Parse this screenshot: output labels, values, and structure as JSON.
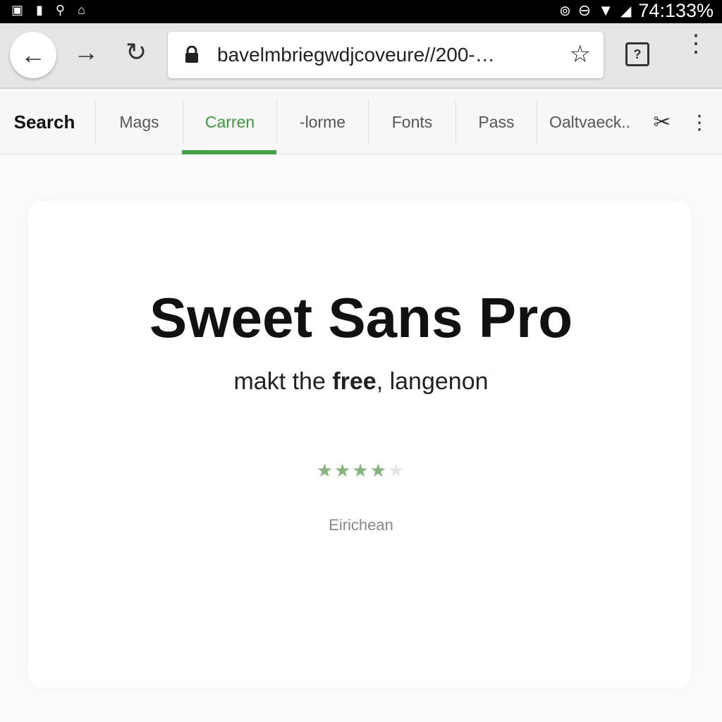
{
  "status_bar": {
    "time_battery": "74:133%"
  },
  "browser": {
    "url": "bavelmbriegwdjcoveure//200-…",
    "icons": [
      "back-arrow-icon",
      "forward-arrow-icon",
      "reload-icon",
      "lock-icon",
      "star-icon",
      "tabs-icon",
      "menu-icon"
    ],
    "tabs_count": "?"
  },
  "tabs": [
    {
      "label": "Search"
    },
    {
      "label": "Mags"
    },
    {
      "label": "Carren",
      "active": true
    },
    {
      "label": "-lorme"
    },
    {
      "label": "Fonts"
    },
    {
      "label": "Pass"
    },
    {
      "label": "Oaltvaeck.."
    }
  ],
  "main": {
    "title": "Sweet Sans Pro",
    "subtitle_pre": "makt the ",
    "subtitle_bold": "free",
    "subtitle_post": ", langenon",
    "rating": 4,
    "rating_max": 5,
    "author": "Eirichean"
  },
  "colors": {
    "accent": "#43a047",
    "star": "#86b47c"
  }
}
